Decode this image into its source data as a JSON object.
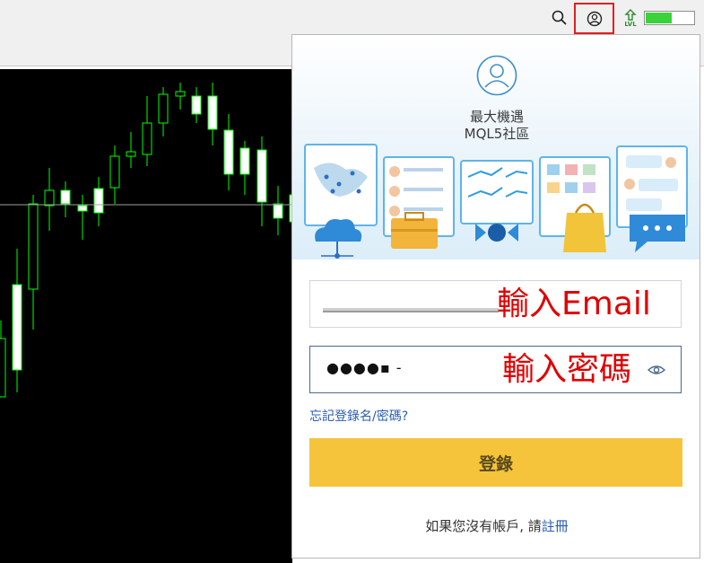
{
  "toolbar": {
    "search_icon": "search-icon",
    "account_icon": "user-circle-icon",
    "level_label": "LVL",
    "battery_level": 0.55,
    "battery_color": "#3bd23b",
    "highlight_color": "#e02020"
  },
  "chart_data": {
    "type": "candlestick",
    "background": "#000000",
    "up_color": "#ffffff",
    "wick_color": "#00ff00",
    "note": ""
  },
  "login": {
    "brand_name": "最大機遇",
    "brand_sub": "MQL5社區",
    "email_annotation": "輸入Email",
    "password_annotation": "輸入密碼",
    "password_mask": "●●●●▪ -",
    "forgot_link": "忘記登錄名/密碼?",
    "login_button": "登錄",
    "signup_prefix": "如果您沒有帳戶, 請",
    "signup_link": "註冊",
    "button_color": "#f5c43a",
    "link_color": "#2a5db0",
    "annotation_color": "#e00000"
  }
}
